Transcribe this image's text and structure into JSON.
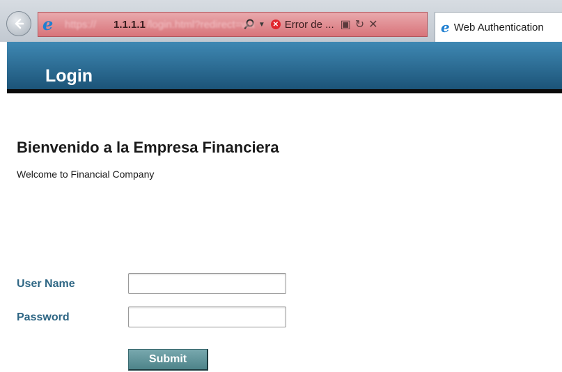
{
  "browser": {
    "url_prefix": "https://",
    "url_host": "1.1.1.1",
    "url_path": "/login.html?redirect=wa",
    "error_tab_label": "Error de ...",
    "active_tab_title": "Web Authentication",
    "icons": {
      "back": "back-arrow-icon",
      "browser": "internet-explorer-icon",
      "search": "search-icon",
      "dropdown": "chevron-down-icon",
      "error": "error-icon",
      "compat": "compatibility-view-icon",
      "refresh": "refresh-icon",
      "stop": "stop-icon"
    }
  },
  "header": {
    "title": "Login"
  },
  "main": {
    "heading": "Bienvenido a la Empresa Financiera",
    "subtitle": "Welcome to Financial Company"
  },
  "form": {
    "username_label": "User Name",
    "username_value": "",
    "password_label": "Password",
    "password_value": "",
    "submit_label": "Submit"
  },
  "colors": {
    "header_gradient_top": "#3f88b3",
    "header_gradient_bottom": "#1c5478",
    "label_color": "#2e6684",
    "button_color": "#5e9197",
    "address_bar_error": "#d8747a"
  }
}
